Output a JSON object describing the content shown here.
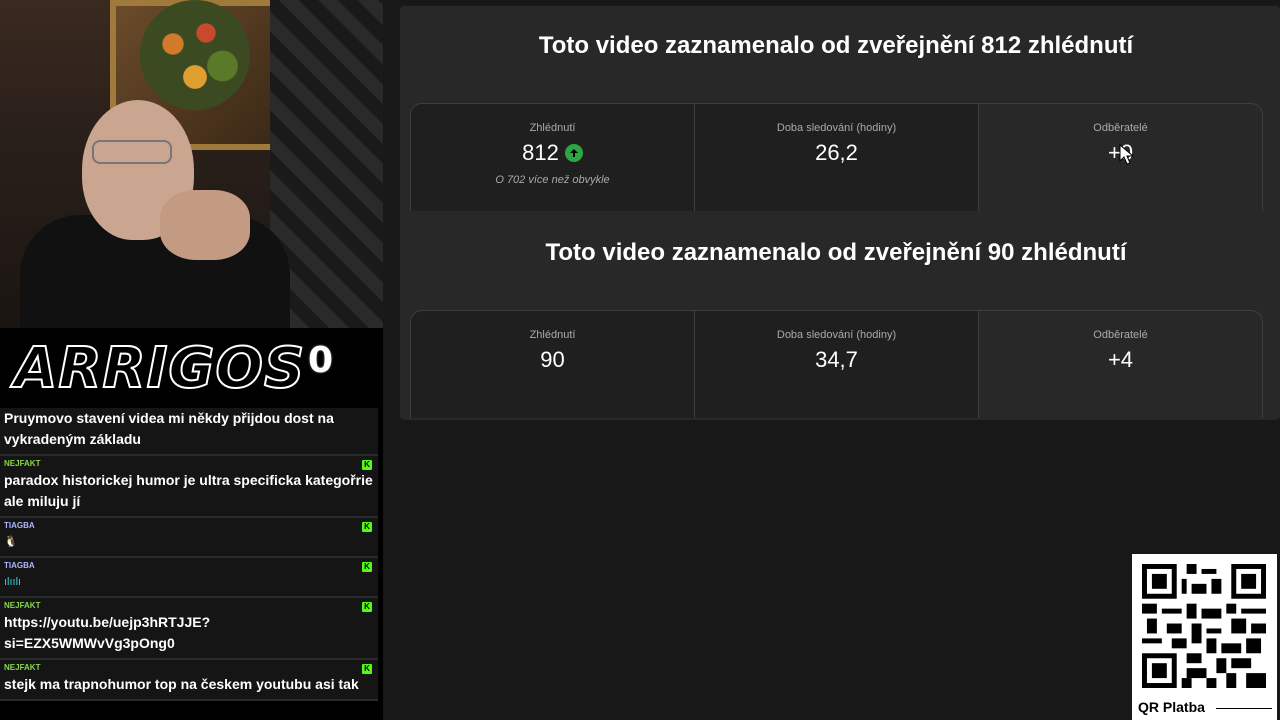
{
  "stream": {
    "brand": "ARRIGOS",
    "counter": "0"
  },
  "chat": {
    "messages": [
      {
        "user": "",
        "text": "Pruymovo stavení videa mi někdy přijdou dost na vykradeným základu",
        "badge": false
      },
      {
        "user": "NEJFAKT",
        "text": "paradox historickej humor je ultra specificka kategořrie ale miluju jí",
        "badge": true
      },
      {
        "user": "TIAGBA",
        "text": "",
        "emote": "🐧",
        "badge": true
      },
      {
        "user": "TIAGBA",
        "text": "",
        "emote": "ılıılı",
        "badge": true
      },
      {
        "user": "NEJFAKT",
        "text": "https://youtu.be/uejp3hRTJJE?si=EZX5WMWvVg3pOng0",
        "badge": true
      },
      {
        "user": "NEJFAKT",
        "text": "stejk ma trapnohumor top na českem youtubu asi tak",
        "badge": true
      }
    ]
  },
  "analytics": {
    "blocks": [
      {
        "headline": "Toto video zaznamenalo od zveřejnění 812 zhlédnutí",
        "cards": [
          {
            "label": "Zhlédnutí",
            "value": "812",
            "note": "O 702 více než obvykle",
            "trend": "up"
          },
          {
            "label": "Doba sledování (hodiny)",
            "value": "26,2"
          },
          {
            "label": "Odběratelé",
            "value": "+0"
          }
        ]
      },
      {
        "headline": "Toto video zaznamenalo od zveřejnění 90 zhlédnutí",
        "cards": [
          {
            "label": "Zhlédnutí",
            "value": "90"
          },
          {
            "label": "Doba sledování (hodiny)",
            "value": "34,7"
          },
          {
            "label": "Odběratelé",
            "value": "+4"
          }
        ]
      }
    ]
  },
  "qr": {
    "label": "QR Platba"
  },
  "colors": {
    "trend_up": "#2ba640",
    "kick_green": "#53fc18",
    "panel_bg": "#282828"
  }
}
